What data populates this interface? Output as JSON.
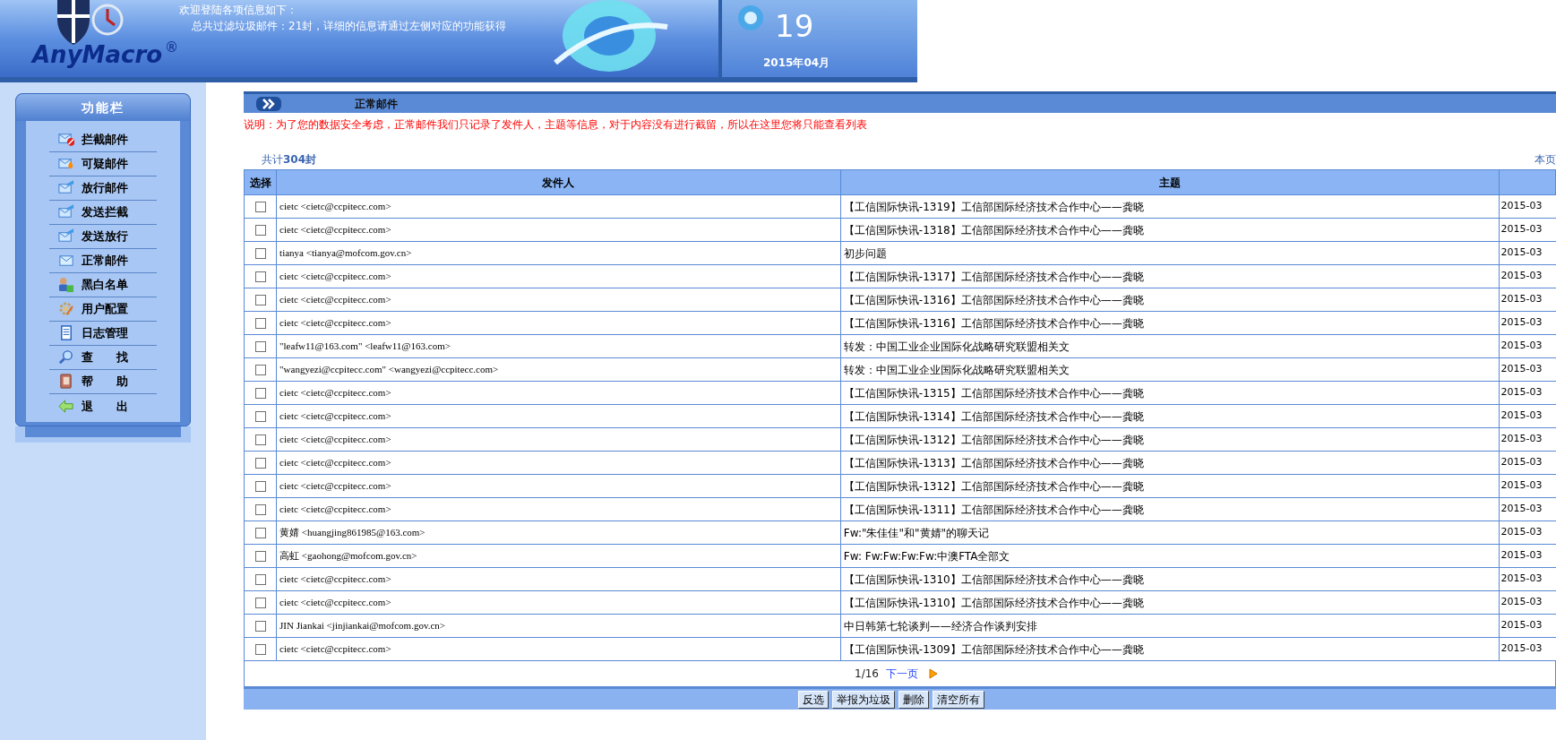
{
  "header": {
    "logo_text": "AnyMacro",
    "logo_mark": "®",
    "welcome": "欢迎登陆各项信息如下：",
    "summary": "总共过滤垃圾邮件：21封，详细的信息请通过左侧对应的功能获得",
    "day": "19",
    "month": "2015年04月"
  },
  "sidebar": {
    "title": "功能栏",
    "items": [
      {
        "label": "拦截邮件",
        "kind": "blocked"
      },
      {
        "label": "可疑邮件",
        "kind": "suspect"
      },
      {
        "label": "放行邮件",
        "kind": "send"
      },
      {
        "label": "发送拦截",
        "kind": "send"
      },
      {
        "label": "发送放行",
        "kind": "send"
      },
      {
        "label": "正常邮件",
        "kind": "mail"
      },
      {
        "label": "黑白名单",
        "kind": "user"
      },
      {
        "label": "用户配置",
        "kind": "gear"
      },
      {
        "label": "日志管理",
        "kind": "log"
      },
      {
        "label": "查　　找",
        "kind": "search"
      },
      {
        "label": "帮　　助",
        "kind": "help"
      },
      {
        "label": "退　　出",
        "kind": "exit"
      }
    ]
  },
  "section_title": "正常邮件",
  "notice": "说明：为了您的数据安全考虑，正常邮件我们只记录了发件人，主题等信息，对于内容没有进行截留，所以在这里您将只能查看列表",
  "total": "共计**304封**",
  "page_label": "本页",
  "table": {
    "columns": [
      "选择",
      "发件人",
      "主题"
    ],
    "rows": [
      {
        "checked": false,
        "sender": "cietc <cietc@ccpitecc.com>",
        "subject": "【工信国际快讯-1319】工信部国际经济技术合作中心——龚晓",
        "date": "2015-03"
      },
      {
        "checked": false,
        "sender": "cietc <cietc@ccpitecc.com>",
        "subject": "【工信国际快讯-1318】工信部国际经济技术合作中心——龚晓",
        "date": "2015-03"
      },
      {
        "checked": false,
        "sender": "tianya <tianya@mofcom.gov.cn>",
        "subject": "初步问题",
        "date": "2015-03"
      },
      {
        "checked": false,
        "sender": "cietc <cietc@ccpitecc.com>",
        "subject": "【工信国际快讯-1317】工信部国际经济技术合作中心——龚晓",
        "date": "2015-03"
      },
      {
        "checked": false,
        "sender": "cietc <cietc@ccpitecc.com>",
        "subject": "【工信国际快讯-1316】工信部国际经济技术合作中心——龚晓",
        "date": "2015-03"
      },
      {
        "checked": false,
        "sender": "cietc <cietc@ccpitecc.com>",
        "subject": "【工信国际快讯-1316】工信部国际经济技术合作中心——龚晓",
        "date": "2015-03"
      },
      {
        "checked": false,
        "sender": "\"leafw11@163.com\" <leafw11@163.com>",
        "subject": "转发：中国工业企业国际化战略研究联盟相关文",
        "date": "2015-03"
      },
      {
        "checked": false,
        "sender": "\"wangyezi@ccpitecc.com\" <wangyezi@ccpitecc.com>",
        "subject": "转发：中国工业企业国际化战略研究联盟相关文",
        "date": "2015-03"
      },
      {
        "checked": false,
        "sender": "cietc <cietc@ccpitecc.com>",
        "subject": "【工信国际快讯-1315】工信部国际经济技术合作中心——龚晓",
        "date": "2015-03"
      },
      {
        "checked": false,
        "sender": "cietc <cietc@ccpitecc.com>",
        "subject": "【工信国际快讯-1314】工信部国际经济技术合作中心——龚晓",
        "date": "2015-03"
      },
      {
        "checked": false,
        "sender": "cietc <cietc@ccpitecc.com>",
        "subject": "【工信国际快讯-1312】工信部国际经济技术合作中心——龚晓",
        "date": "2015-03"
      },
      {
        "checked": false,
        "sender": "cietc <cietc@ccpitecc.com>",
        "subject": "【工信国际快讯-1313】工信部国际经济技术合作中心——龚晓",
        "date": "2015-03"
      },
      {
        "checked": false,
        "sender": "cietc <cietc@ccpitecc.com>",
        "subject": "【工信国际快讯-1312】工信部国际经济技术合作中心——龚晓",
        "date": "2015-03"
      },
      {
        "checked": false,
        "sender": "cietc <cietc@ccpitecc.com>",
        "subject": "【工信国际快讯-1311】工信部国际经济技术合作中心——龚晓",
        "date": "2015-03"
      },
      {
        "checked": false,
        "sender": "黄婧 <huangjing861985@163.com>",
        "subject": "Fw:\"朱佳佳\"和\"黄婧\"的聊天记",
        "date": "2015-03"
      },
      {
        "checked": false,
        "sender": "高虹 <gaohong@mofcom.gov.cn>",
        "subject": "Fw: Fw:Fw:Fw:Fw:中澳FTA全部文",
        "date": "2015-03"
      },
      {
        "checked": false,
        "sender": "cietc <cietc@ccpitecc.com>",
        "subject": "【工信国际快讯-1310】工信部国际经济技术合作中心——龚晓",
        "date": "2015-03"
      },
      {
        "checked": false,
        "sender": "cietc <cietc@ccpitecc.com>",
        "subject": "【工信国际快讯-1310】工信部国际经济技术合作中心——龚晓",
        "date": "2015-03"
      },
      {
        "checked": false,
        "sender": "JIN Jiankai <jinjiankai@mofcom.gov.cn>",
        "subject": "中日韩第七轮谈判——经济合作谈判安排",
        "date": "2015-03"
      },
      {
        "checked": false,
        "sender": "cietc <cietc@ccpitecc.com>",
        "subject": "【工信国际快讯-1309】工信部国际经济技术合作中心——龚晓",
        "date": "2015-03"
      }
    ]
  },
  "pager": {
    "position": "1/16",
    "next": "下一页"
  },
  "buttons": [
    "反选",
    "举报为垃圾",
    "删除",
    "清空所有"
  ]
}
